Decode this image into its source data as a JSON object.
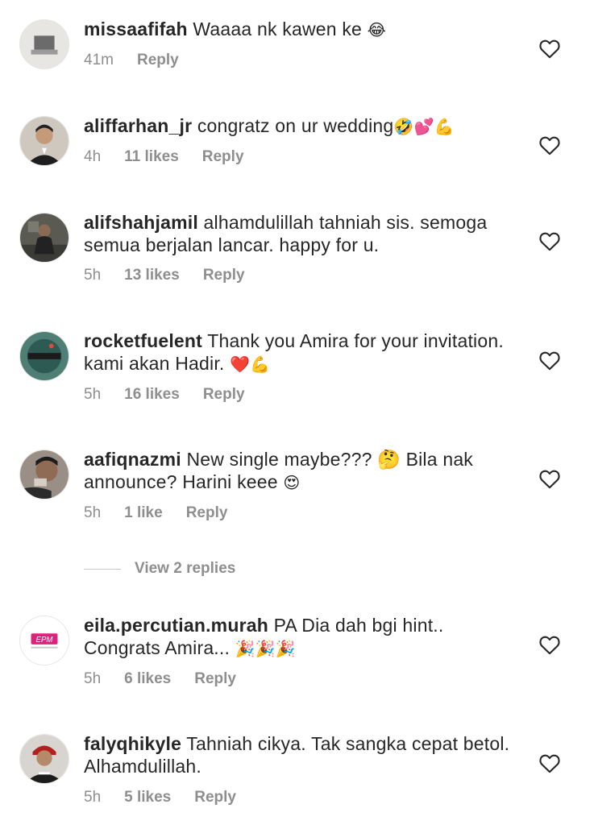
{
  "comments": [
    {
      "username": "missaafifah",
      "text": "Waaaa nk kawen ke",
      "emoji": "😂",
      "time": "41m",
      "likes": "",
      "reply": "Reply",
      "avatar": "avatar-photo"
    },
    {
      "username": "aliffarhan_jr",
      "text": "congratz on ur wedding",
      "emoji": "🤣💕💪",
      "time": "4h",
      "likes": "11 likes",
      "reply": "Reply",
      "avatar": "avatar-photo"
    },
    {
      "username": "alifshahjamil",
      "text": "alhamdulillah tahniah sis. semoga semua berjalan lancar. happy for u.",
      "emoji": "",
      "time": "5h",
      "likes": "13 likes",
      "reply": "Reply",
      "avatar": "avatar-photo"
    },
    {
      "username": "rocketfuelent",
      "text": "Thank you Amira for your invitation. kami akan Hadir.",
      "emoji": "❤️💪",
      "time": "5h",
      "likes": "16 likes",
      "reply": "Reply",
      "avatar": "logo-avatar"
    },
    {
      "username": "aafiqnazmi",
      "text": "New single maybe??? 🤔 Bila nak announce? Harini keee",
      "emoji": "😍",
      "time": "5h",
      "likes": "1 like",
      "reply": "Reply",
      "avatar": "avatar-photo"
    },
    {
      "username": "eila.percutian.murah",
      "text": "PA Dia dah bgi hint.. Congrats Amira...",
      "emoji": "🎉🎉🎉",
      "time": "5h",
      "likes": "6 likes",
      "reply": "Reply",
      "avatar": "logo-avatar"
    },
    {
      "username": "falyqhikyle",
      "text": "Tahniah cikya. Tak sangka cepat betol. Alhamdulillah.",
      "emoji": "",
      "time": "5h",
      "likes": "5 likes",
      "reply": "Reply",
      "avatar": "avatar-photo"
    }
  ],
  "view_replies": "View 2 replies",
  "colors": {
    "text": "#262626",
    "muted": "#8e8e8e",
    "divider": "#c7c7c7"
  }
}
